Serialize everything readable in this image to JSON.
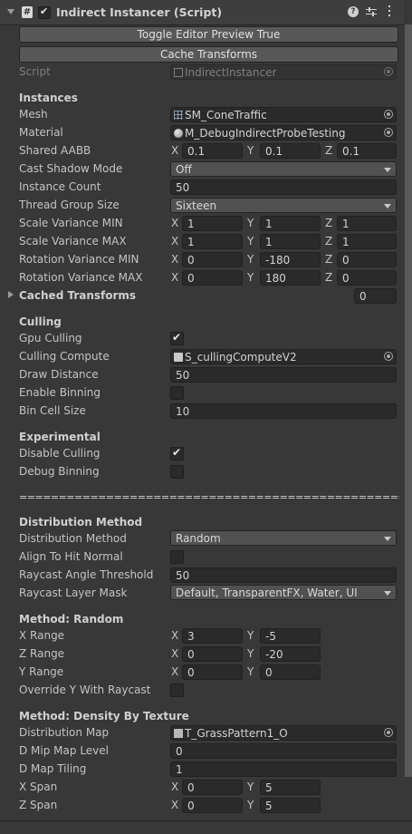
{
  "header": {
    "title": "Indirect Instancer (Script)",
    "enabled": true
  },
  "buttons": {
    "toggle_preview": "Toggle Editor Preview True",
    "cache_transforms": "Cache Transforms"
  },
  "script": {
    "label": "Script",
    "value": "IndirectInstancer"
  },
  "instances": {
    "title": "Instances",
    "mesh": {
      "label": "Mesh",
      "value": "SM_ConeTraffic"
    },
    "material": {
      "label": "Material",
      "value": "M_DebugIndirectProbeTesting"
    },
    "shared_aabb": {
      "label": "Shared AABB",
      "x": "0.1",
      "y": "0.1",
      "z": "0.1"
    },
    "cast_shadow": {
      "label": "Cast Shadow Mode",
      "value": "Off"
    },
    "instance_count": {
      "label": "Instance Count",
      "value": "50"
    },
    "thread_group": {
      "label": "Thread Group Size",
      "value": "Sixteen"
    },
    "scale_min": {
      "label": "Scale Variance MIN",
      "x": "1",
      "y": "1",
      "z": "1"
    },
    "scale_max": {
      "label": "Scale Variance MAX",
      "x": "1",
      "y": "1",
      "z": "1"
    },
    "rot_min": {
      "label": "Rotation Variance MIN",
      "x": "0",
      "y": "-180",
      "z": "0"
    },
    "rot_max": {
      "label": "Rotation Variance MAX",
      "x": "0",
      "y": "180",
      "z": "0"
    },
    "cached": {
      "label": "Cached Transforms",
      "value": "0"
    }
  },
  "culling": {
    "title": "Culling",
    "gpu": {
      "label": "Gpu Culling",
      "checked": true
    },
    "compute": {
      "label": "Culling Compute",
      "value": "S_cullingComputeV2"
    },
    "draw_distance": {
      "label": "Draw Distance",
      "value": "50"
    },
    "binning": {
      "label": "Enable Binning",
      "checked": false
    },
    "bin_cell": {
      "label": "Bin Cell Size",
      "value": "10"
    }
  },
  "experimental": {
    "title": "Experimental",
    "disable_culling": {
      "label": "Disable Culling",
      "checked": true
    },
    "debug_binning": {
      "label": "Debug Binning",
      "checked": false
    }
  },
  "separator": "===========================================================",
  "distribution": {
    "title": "Distribution Method",
    "method": {
      "label": "Distribution Method",
      "value": "Random"
    },
    "align": {
      "label": "Align To Hit Normal",
      "checked": false
    },
    "angle": {
      "label": "Raycast Angle Threshold",
      "value": "50"
    },
    "mask": {
      "label": "Raycast Layer Mask",
      "value": "Default, TransparentFX, Water, UI"
    }
  },
  "random": {
    "title": "Method: Random",
    "x_range": {
      "label": "X Range",
      "x": "3",
      "y": "-5"
    },
    "z_range": {
      "label": "Z Range",
      "x": "0",
      "y": "-20"
    },
    "y_range": {
      "label": "Y Range",
      "x": "0",
      "y": "0"
    },
    "override_y": {
      "label": "Override Y With Raycast",
      "checked": false
    }
  },
  "density": {
    "title": "Method: Density By Texture",
    "map": {
      "label": "Distribution Map",
      "value": "T_GrassPattern1_O"
    },
    "mip": {
      "label": "D Mip Map Level",
      "value": "0"
    },
    "tiling": {
      "label": "D Map Tiling",
      "value": "1"
    },
    "x_span": {
      "label": "X Span",
      "x": "0",
      "y": "5"
    },
    "z_span": {
      "label": "Z Span",
      "x": "0",
      "y": "5"
    }
  },
  "axes": {
    "x": "X",
    "y": "Y",
    "z": "Z"
  },
  "icons": {
    "fold": "triangle-down-icon",
    "script": "hash-icon",
    "help": "help-icon",
    "presets": "sliders-icon",
    "menu": "kebab-icon"
  }
}
